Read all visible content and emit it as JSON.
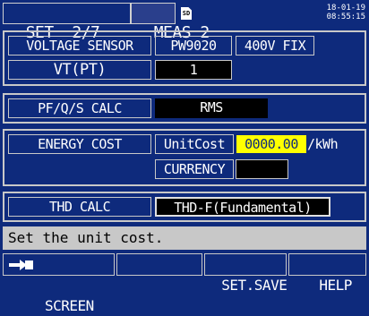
{
  "header": {
    "tabs": [
      {
        "label": "SET  2/7",
        "active": true
      },
      {
        "label": "MEAS 2",
        "active": false
      }
    ],
    "sd_icon": "SD",
    "date": "18-01-19",
    "time": "08:55:15"
  },
  "voltage_sensor": {
    "label": "VOLTAGE SENSOR",
    "model": "PW9020",
    "range": "400V FIX",
    "vt_label": "VT(PT)",
    "vt_value": "1"
  },
  "pfqs": {
    "label": "PF/Q/S CALC",
    "value": "RMS"
  },
  "energy_cost": {
    "label": "ENERGY COST",
    "unitcost_label": "UnitCost",
    "unitcost_value": "0000.00",
    "unit": "/kWh",
    "currency_label": "CURRENCY",
    "currency_value": ""
  },
  "thd": {
    "label": "THD CALC",
    "value": "THD-F(Fundamental)"
  },
  "status_message": "Set the unit cost.",
  "function_keys": [
    {
      "label": "SCREEN",
      "icon": "screen-switch-icon"
    },
    {
      "label": ""
    },
    {
      "label": "SET.SAVE"
    },
    {
      "label": "HELP"
    }
  ],
  "colors": {
    "background": "#0e2a7c",
    "highlight": "#ffff00",
    "status_bar": "#c8c8c8"
  }
}
